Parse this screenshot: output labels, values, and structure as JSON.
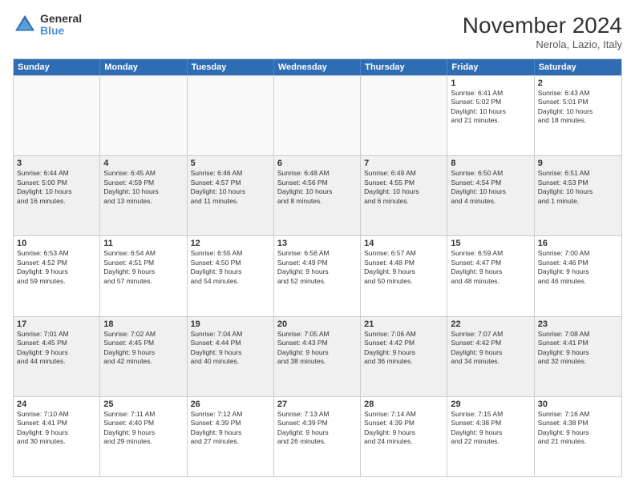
{
  "logo": {
    "line1": "General",
    "line2": "Blue"
  },
  "title": "November 2024",
  "location": "Nerola, Lazio, Italy",
  "header_days": [
    "Sunday",
    "Monday",
    "Tuesday",
    "Wednesday",
    "Thursday",
    "Friday",
    "Saturday"
  ],
  "rows": [
    [
      {
        "day": "",
        "info": "",
        "empty": true
      },
      {
        "day": "",
        "info": "",
        "empty": true
      },
      {
        "day": "",
        "info": "",
        "empty": true
      },
      {
        "day": "",
        "info": "",
        "empty": true
      },
      {
        "day": "",
        "info": "",
        "empty": true
      },
      {
        "day": "1",
        "info": "Sunrise: 6:41 AM\nSunset: 5:02 PM\nDaylight: 10 hours\nand 21 minutes.",
        "empty": false
      },
      {
        "day": "2",
        "info": "Sunrise: 6:43 AM\nSunset: 5:01 PM\nDaylight: 10 hours\nand 18 minutes.",
        "empty": false
      }
    ],
    [
      {
        "day": "3",
        "info": "Sunrise: 6:44 AM\nSunset: 5:00 PM\nDaylight: 10 hours\nand 16 minutes.",
        "empty": false
      },
      {
        "day": "4",
        "info": "Sunrise: 6:45 AM\nSunset: 4:59 PM\nDaylight: 10 hours\nand 13 minutes.",
        "empty": false
      },
      {
        "day": "5",
        "info": "Sunrise: 6:46 AM\nSunset: 4:57 PM\nDaylight: 10 hours\nand 11 minutes.",
        "empty": false
      },
      {
        "day": "6",
        "info": "Sunrise: 6:48 AM\nSunset: 4:56 PM\nDaylight: 10 hours\nand 8 minutes.",
        "empty": false
      },
      {
        "day": "7",
        "info": "Sunrise: 6:49 AM\nSunset: 4:55 PM\nDaylight: 10 hours\nand 6 minutes.",
        "empty": false
      },
      {
        "day": "8",
        "info": "Sunrise: 6:50 AM\nSunset: 4:54 PM\nDaylight: 10 hours\nand 4 minutes.",
        "empty": false
      },
      {
        "day": "9",
        "info": "Sunrise: 6:51 AM\nSunset: 4:53 PM\nDaylight: 10 hours\nand 1 minute.",
        "empty": false
      }
    ],
    [
      {
        "day": "10",
        "info": "Sunrise: 6:53 AM\nSunset: 4:52 PM\nDaylight: 9 hours\nand 59 minutes.",
        "empty": false
      },
      {
        "day": "11",
        "info": "Sunrise: 6:54 AM\nSunset: 4:51 PM\nDaylight: 9 hours\nand 57 minutes.",
        "empty": false
      },
      {
        "day": "12",
        "info": "Sunrise: 6:55 AM\nSunset: 4:50 PM\nDaylight: 9 hours\nand 54 minutes.",
        "empty": false
      },
      {
        "day": "13",
        "info": "Sunrise: 6:56 AM\nSunset: 4:49 PM\nDaylight: 9 hours\nand 52 minutes.",
        "empty": false
      },
      {
        "day": "14",
        "info": "Sunrise: 6:57 AM\nSunset: 4:48 PM\nDaylight: 9 hours\nand 50 minutes.",
        "empty": false
      },
      {
        "day": "15",
        "info": "Sunrise: 6:59 AM\nSunset: 4:47 PM\nDaylight: 9 hours\nand 48 minutes.",
        "empty": false
      },
      {
        "day": "16",
        "info": "Sunrise: 7:00 AM\nSunset: 4:46 PM\nDaylight: 9 hours\nand 46 minutes.",
        "empty": false
      }
    ],
    [
      {
        "day": "17",
        "info": "Sunrise: 7:01 AM\nSunset: 4:45 PM\nDaylight: 9 hours\nand 44 minutes.",
        "empty": false
      },
      {
        "day": "18",
        "info": "Sunrise: 7:02 AM\nSunset: 4:45 PM\nDaylight: 9 hours\nand 42 minutes.",
        "empty": false
      },
      {
        "day": "19",
        "info": "Sunrise: 7:04 AM\nSunset: 4:44 PM\nDaylight: 9 hours\nand 40 minutes.",
        "empty": false
      },
      {
        "day": "20",
        "info": "Sunrise: 7:05 AM\nSunset: 4:43 PM\nDaylight: 9 hours\nand 38 minutes.",
        "empty": false
      },
      {
        "day": "21",
        "info": "Sunrise: 7:06 AM\nSunset: 4:42 PM\nDaylight: 9 hours\nand 36 minutes.",
        "empty": false
      },
      {
        "day": "22",
        "info": "Sunrise: 7:07 AM\nSunset: 4:42 PM\nDaylight: 9 hours\nand 34 minutes.",
        "empty": false
      },
      {
        "day": "23",
        "info": "Sunrise: 7:08 AM\nSunset: 4:41 PM\nDaylight: 9 hours\nand 32 minutes.",
        "empty": false
      }
    ],
    [
      {
        "day": "24",
        "info": "Sunrise: 7:10 AM\nSunset: 4:41 PM\nDaylight: 9 hours\nand 30 minutes.",
        "empty": false
      },
      {
        "day": "25",
        "info": "Sunrise: 7:11 AM\nSunset: 4:40 PM\nDaylight: 9 hours\nand 29 minutes.",
        "empty": false
      },
      {
        "day": "26",
        "info": "Sunrise: 7:12 AM\nSunset: 4:39 PM\nDaylight: 9 hours\nand 27 minutes.",
        "empty": false
      },
      {
        "day": "27",
        "info": "Sunrise: 7:13 AM\nSunset: 4:39 PM\nDaylight: 9 hours\nand 26 minutes.",
        "empty": false
      },
      {
        "day": "28",
        "info": "Sunrise: 7:14 AM\nSunset: 4:39 PM\nDaylight: 9 hours\nand 24 minutes.",
        "empty": false
      },
      {
        "day": "29",
        "info": "Sunrise: 7:15 AM\nSunset: 4:38 PM\nDaylight: 9 hours\nand 22 minutes.",
        "empty": false
      },
      {
        "day": "30",
        "info": "Sunrise: 7:16 AM\nSunset: 4:38 PM\nDaylight: 9 hours\nand 21 minutes.",
        "empty": false
      }
    ]
  ]
}
